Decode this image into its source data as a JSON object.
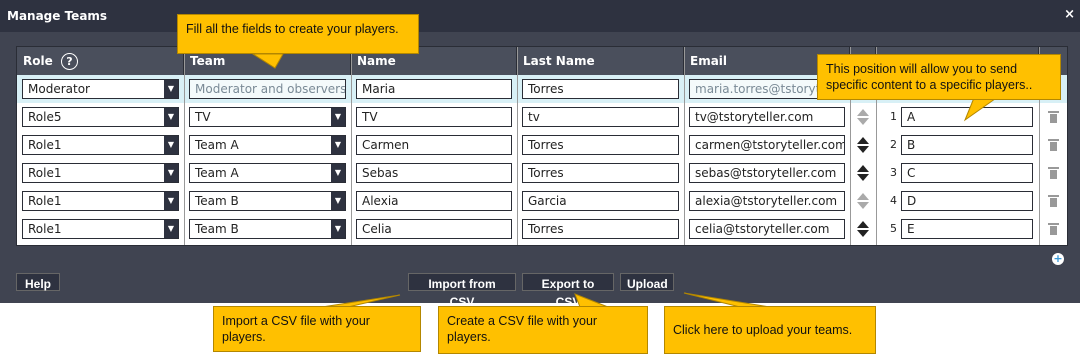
{
  "window": {
    "title": "Manage Teams",
    "close_symbol": "×"
  },
  "columns": {
    "role": "Role",
    "role_help": "?",
    "team": "Team",
    "name": "Name",
    "last_name": "Last Name",
    "email": "Email"
  },
  "rows": [
    {
      "role": "Moderator",
      "team": "Moderator and observers te",
      "name": "Maria",
      "last_name": "Torres",
      "email": "maria.torres@tstoryteller.com",
      "pos": "",
      "pos_value": ""
    },
    {
      "role": "Role5",
      "team": "TV",
      "name": "TV",
      "last_name": "tv",
      "email": "tv@tstoryteller.com",
      "pos": "1",
      "pos_value": "A"
    },
    {
      "role": "Role1",
      "team": "Team A",
      "name": "Carmen",
      "last_name": "Torres",
      "email": "carmen@tstoryteller.com",
      "pos": "2",
      "pos_value": "B"
    },
    {
      "role": "Role1",
      "team": "Team A",
      "name": "Sebas",
      "last_name": "Torres",
      "email": "sebas@tstoryteller.com",
      "pos": "3",
      "pos_value": "C"
    },
    {
      "role": "Role1",
      "team": "Team B",
      "name": "Alexia",
      "last_name": "Garcia",
      "email": "alexia@tstoryteller.com",
      "pos": "4",
      "pos_value": "D"
    },
    {
      "role": "Role1",
      "team": "Team B",
      "name": "Celia",
      "last_name": "Torres",
      "email": "celia@tstoryteller.com",
      "pos": "5",
      "pos_value": "E"
    }
  ],
  "buttons": {
    "help": "Help",
    "import": "Import from CSV",
    "export": "Export to CSV",
    "upload": "Upload",
    "add": "+"
  },
  "callouts": {
    "fields": "Fill all the fields to create your players.",
    "position": "This position will allow you to send specific content to a specific players..",
    "import": "Import a CSV file with your players.",
    "export": "Create a CSV file with your players.",
    "upload": "Click here to upload your teams."
  },
  "colors": {
    "callout": "#ffc000",
    "modal": "#404451",
    "header": "#4a4f5c"
  }
}
